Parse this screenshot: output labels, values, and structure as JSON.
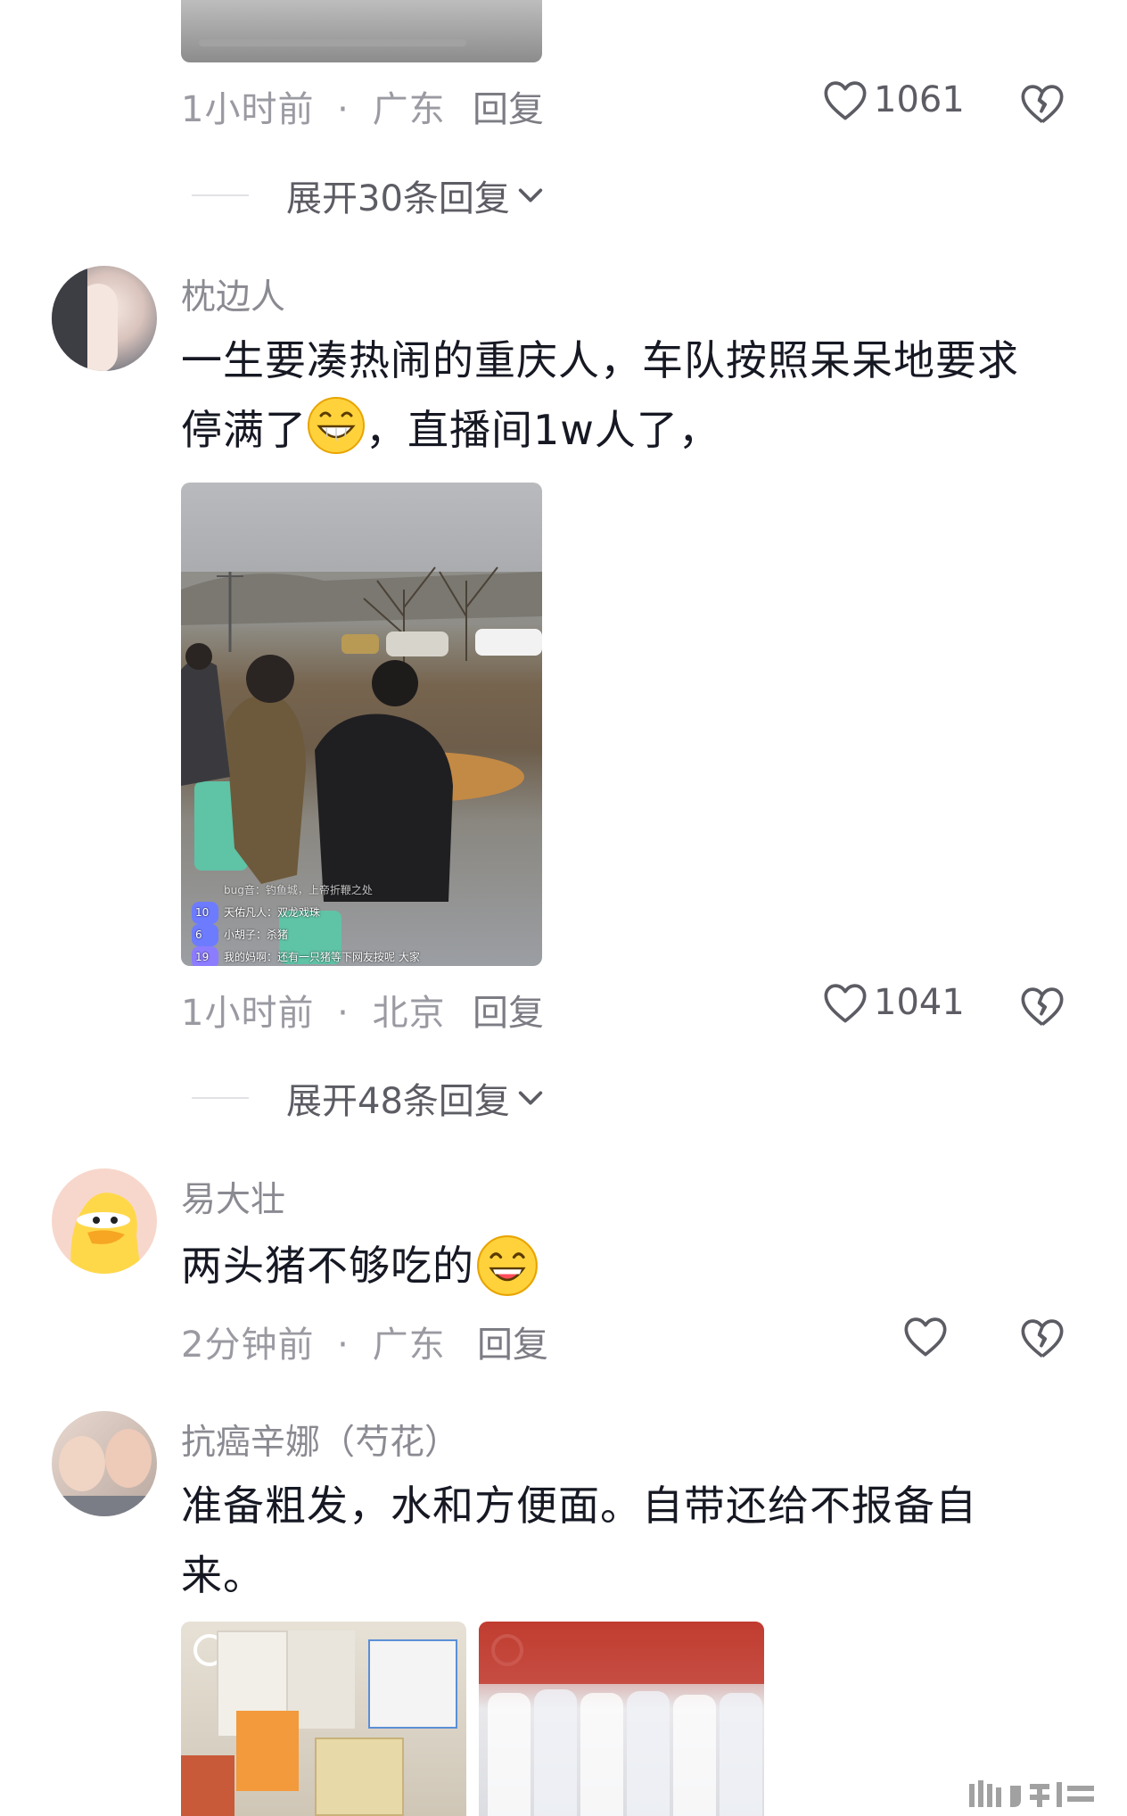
{
  "comments": [
    {
      "time": "1小时前",
      "location": "广东",
      "reply_label": "回复",
      "likes": "1061",
      "expand_label": "展开30条回复"
    },
    {
      "username": "枕边人",
      "text_line1": "一生要凑热闹的重庆人，车队按照呆呆地要求",
      "text_line2a": "停满了",
      "text_line2b": "，直播间1w人了，",
      "time": "1小时前",
      "location": "北京",
      "reply_label": "回复",
      "likes": "1041",
      "expand_label": "展开48条回复",
      "live_chat": [
        "bug音：钓鱼城，上帝折鞭之处",
        "天佑凡人：双龙戏珠",
        "小胡子：杀猪",
        "我的妈啊：还有一只猪等下网友按呢 大家"
      ],
      "live_levels": [
        "",
        "10",
        "6",
        "19"
      ]
    },
    {
      "username": "易大壮",
      "text": "两头猪不够吃的",
      "time": "2分钟前",
      "location": "广东",
      "reply_label": "回复"
    },
    {
      "username": "抗癌辛娜（芍花）",
      "text_line1": "准备粗发，水和方便面。自带还给不报备自",
      "text_line2": "来。"
    }
  ],
  "meta_separator": "·",
  "icons": [
    "heart-icon",
    "broken-heart-icon",
    "chevron-down-icon"
  ],
  "colors": {
    "text": "#161823",
    "meta": "#9a9aa2",
    "icon": "#5c5c64"
  }
}
